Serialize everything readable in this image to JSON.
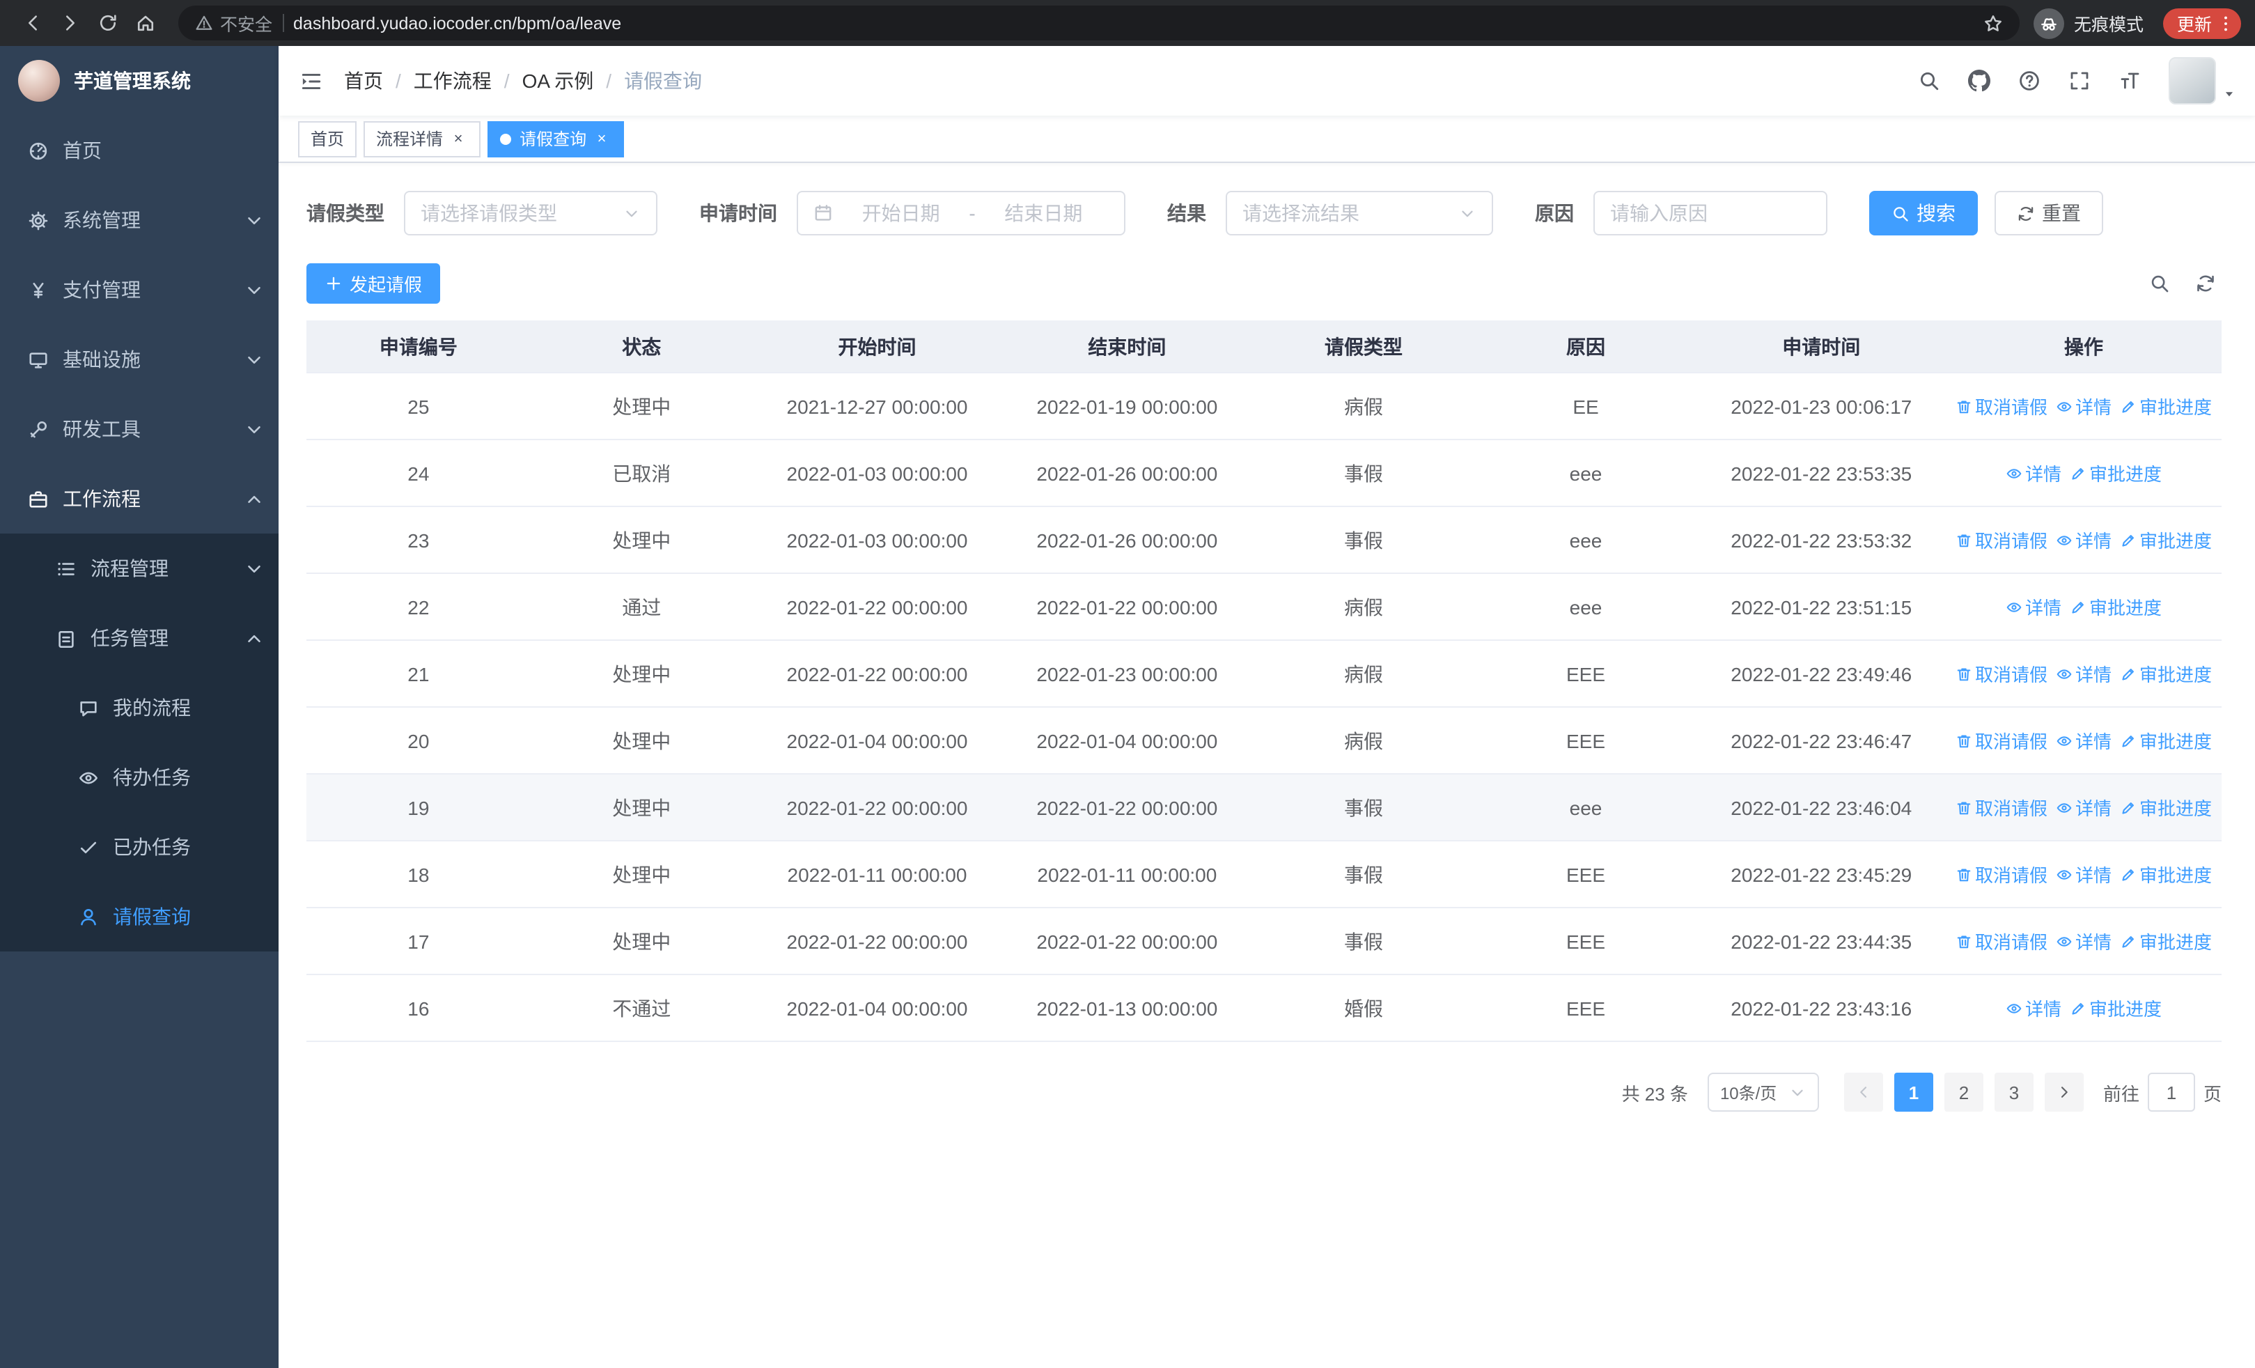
{
  "browser": {
    "security_warning": "不安全",
    "url": "dashboard.yudao.iocoder.cn/bpm/oa/leave",
    "incognito_label": "无痕模式",
    "update_label": "更新"
  },
  "sidebar": {
    "logo_title": "芋道管理系统",
    "menu": [
      {
        "name": "home",
        "label": "首页",
        "icon": "dashboard-icon",
        "level": 1
      },
      {
        "name": "system-management",
        "label": "系统管理",
        "icon": "gear-icon",
        "level": 1,
        "arrow": "down"
      },
      {
        "name": "payment-management",
        "label": "支付管理",
        "icon": "yen-icon",
        "level": 1,
        "arrow": "down"
      },
      {
        "name": "infrastructure",
        "label": "基础设施",
        "icon": "monitor-icon",
        "level": 1,
        "arrow": "down"
      },
      {
        "name": "dev-tools",
        "label": "研发工具",
        "icon": "wrench-icon",
        "level": 1,
        "arrow": "down"
      },
      {
        "name": "workflow",
        "label": "工作流程",
        "icon": "briefcase-icon",
        "level": 1,
        "arrow": "up",
        "open": true
      },
      {
        "name": "process-management",
        "label": "流程管理",
        "icon": "list-icon",
        "level": 2,
        "sub": true,
        "arrow": "down"
      },
      {
        "name": "task-management",
        "label": "任务管理",
        "icon": "clipboard-icon",
        "level": 2,
        "sub": true,
        "arrow": "up",
        "open": true
      },
      {
        "name": "my-process",
        "label": "我的流程",
        "icon": "chat-icon",
        "level": 3,
        "sub": true
      },
      {
        "name": "todo-tasks",
        "label": "待办任务",
        "icon": "eye-icon",
        "level": 3,
        "sub": true
      },
      {
        "name": "done-tasks",
        "label": "已办任务",
        "icon": "check-icon",
        "level": 3,
        "sub": true
      },
      {
        "name": "leave-query",
        "label": "请假查询",
        "icon": "user-icon",
        "level": 3,
        "sub": true,
        "active": true
      }
    ]
  },
  "header": {
    "breadcrumb": [
      "首页",
      "工作流程",
      "OA 示例",
      "请假查询"
    ],
    "separator": "/"
  },
  "tags": [
    {
      "label": "首页",
      "closable": false,
      "active": false
    },
    {
      "label": "流程详情",
      "closable": true,
      "active": false
    },
    {
      "label": "请假查询",
      "closable": true,
      "active": true
    }
  ],
  "filters": {
    "leave_type_label": "请假类型",
    "leave_type_placeholder": "请选择请假类型",
    "apply_time_label": "申请时间",
    "start_placeholder": "开始日期",
    "range_separator": "-",
    "end_placeholder": "结束日期",
    "result_label": "结果",
    "result_placeholder": "请选择流结果",
    "reason_label": "原因",
    "reason_placeholder": "请输入原因",
    "search_label": "搜索",
    "reset_label": "重置"
  },
  "toolbar": {
    "create_label": "发起请假"
  },
  "table": {
    "columns": [
      "申请编号",
      "状态",
      "开始时间",
      "结束时间",
      "请假类型",
      "原因",
      "申请时间",
      "操作"
    ],
    "action_defs": {
      "cancel": {
        "label": "取消请假",
        "icon": "trash-icon"
      },
      "detail": {
        "label": "详情",
        "icon": "eye-icon"
      },
      "progress": {
        "label": "审批进度",
        "icon": "edit-icon"
      }
    },
    "rows": [
      {
        "id": "25",
        "status": "处理中",
        "start_time": "2021-12-27 00:00:00",
        "end_time": "2022-01-19 00:00:00",
        "leave_type": "病假",
        "reason": "EE",
        "apply_time": "2022-01-23 00:06:17",
        "actions": [
          "cancel",
          "detail",
          "progress"
        ]
      },
      {
        "id": "24",
        "status": "已取消",
        "start_time": "2022-01-03 00:00:00",
        "end_time": "2022-01-26 00:00:00",
        "leave_type": "事假",
        "reason": "eee",
        "apply_time": "2022-01-22 23:53:35",
        "actions": [
          "detail",
          "progress"
        ]
      },
      {
        "id": "23",
        "status": "处理中",
        "start_time": "2022-01-03 00:00:00",
        "end_time": "2022-01-26 00:00:00",
        "leave_type": "事假",
        "reason": "eee",
        "apply_time": "2022-01-22 23:53:32",
        "actions": [
          "cancel",
          "detail",
          "progress"
        ]
      },
      {
        "id": "22",
        "status": "通过",
        "start_time": "2022-01-22 00:00:00",
        "end_time": "2022-01-22 00:00:00",
        "leave_type": "病假",
        "reason": "eee",
        "apply_time": "2022-01-22 23:51:15",
        "actions": [
          "detail",
          "progress"
        ]
      },
      {
        "id": "21",
        "status": "处理中",
        "start_time": "2022-01-22 00:00:00",
        "end_time": "2022-01-23 00:00:00",
        "leave_type": "病假",
        "reason": "EEE",
        "apply_time": "2022-01-22 23:49:46",
        "actions": [
          "cancel",
          "detail",
          "progress"
        ]
      },
      {
        "id": "20",
        "status": "处理中",
        "start_time": "2022-01-04 00:00:00",
        "end_time": "2022-01-04 00:00:00",
        "leave_type": "病假",
        "reason": "EEE",
        "apply_time": "2022-01-22 23:46:47",
        "actions": [
          "cancel",
          "detail",
          "progress"
        ]
      },
      {
        "id": "19",
        "status": "处理中",
        "start_time": "2022-01-22 00:00:00",
        "end_time": "2022-01-22 00:00:00",
        "leave_type": "事假",
        "reason": "eee",
        "apply_time": "2022-01-22 23:46:04",
        "actions": [
          "cancel",
          "detail",
          "progress"
        ],
        "hovered": true
      },
      {
        "id": "18",
        "status": "处理中",
        "start_time": "2022-01-11 00:00:00",
        "end_time": "2022-01-11 00:00:00",
        "leave_type": "事假",
        "reason": "EEE",
        "apply_time": "2022-01-22 23:45:29",
        "actions": [
          "cancel",
          "detail",
          "progress"
        ]
      },
      {
        "id": "17",
        "status": "处理中",
        "start_time": "2022-01-22 00:00:00",
        "end_time": "2022-01-22 00:00:00",
        "leave_type": "事假",
        "reason": "EEE",
        "apply_time": "2022-01-22 23:44:35",
        "actions": [
          "cancel",
          "detail",
          "progress"
        ]
      },
      {
        "id": "16",
        "status": "不通过",
        "start_time": "2022-01-04 00:00:00",
        "end_time": "2022-01-13 00:00:00",
        "leave_type": "婚假",
        "reason": "EEE",
        "apply_time": "2022-01-22 23:43:16",
        "actions": [
          "detail",
          "progress"
        ]
      }
    ]
  },
  "pagination": {
    "total_text": "共 23 条",
    "page_size_label": "10条/页",
    "pages": [
      "1",
      "2",
      "3"
    ],
    "active_page": "1",
    "goto_label": "前往",
    "goto_value": "1",
    "goto_suffix": "页"
  },
  "colors": {
    "primary": "#409eff",
    "sidebar_bg": "#304156",
    "submenu_bg": "#1f2d3d",
    "active_tag_bg": "#409eff",
    "table_header_bg": "#eef1f6"
  }
}
